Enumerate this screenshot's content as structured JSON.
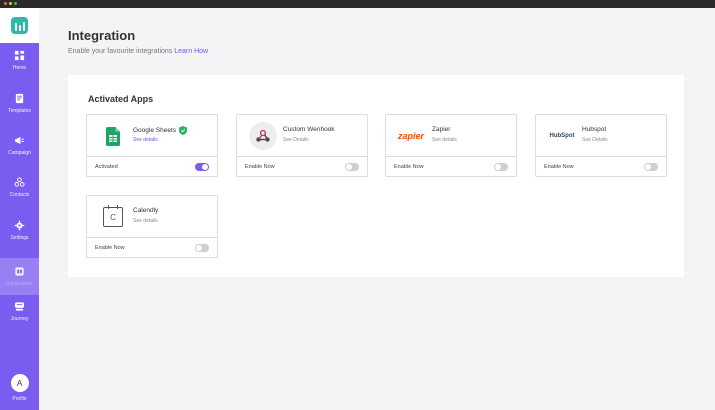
{
  "sidebar": {
    "items": [
      {
        "label": "Home",
        "icon": "grid-icon"
      },
      {
        "label": "Templates",
        "icon": "document-icon"
      },
      {
        "label": "Campaign",
        "icon": "megaphone-icon"
      },
      {
        "label": "Contacts",
        "icon": "contacts-icon"
      },
      {
        "label": "Settings",
        "icon": "gear-icon"
      },
      {
        "label": "Integrations",
        "icon": "integration-icon",
        "active": true
      },
      {
        "label": "Journey",
        "icon": "journey-icon"
      }
    ],
    "profile": {
      "initial": "A",
      "label": "Profile"
    },
    "accent": "#7b5cf0"
  },
  "header": {
    "title": "Integration",
    "subtitle": "Enable your favourite integrations",
    "learn_link": "Learn How"
  },
  "panel": {
    "title": "Activated Apps"
  },
  "apps": [
    {
      "name": "Google Sheets",
      "details": "See details",
      "status": "Activated",
      "enabled": true,
      "verified": true,
      "icon": "google-sheets-icon"
    },
    {
      "name": "Custom Wenhook",
      "details": "See Details",
      "status": "Enable Now",
      "enabled": false,
      "icon": "webhook-icon"
    },
    {
      "name": "Zapier",
      "details": "See details",
      "status": "Enable Now",
      "enabled": false,
      "icon": "zapier-logo",
      "brand": "zapier"
    },
    {
      "name": "Hubspot",
      "details": "See Details",
      "status": "Enable Now",
      "enabled": false,
      "icon": "hubspot-logo",
      "brand": "HubSpot"
    },
    {
      "name": "Calendly",
      "details": "See details",
      "status": "Enable Now",
      "enabled": false,
      "icon": "calendar-icon",
      "brand": "C"
    }
  ]
}
